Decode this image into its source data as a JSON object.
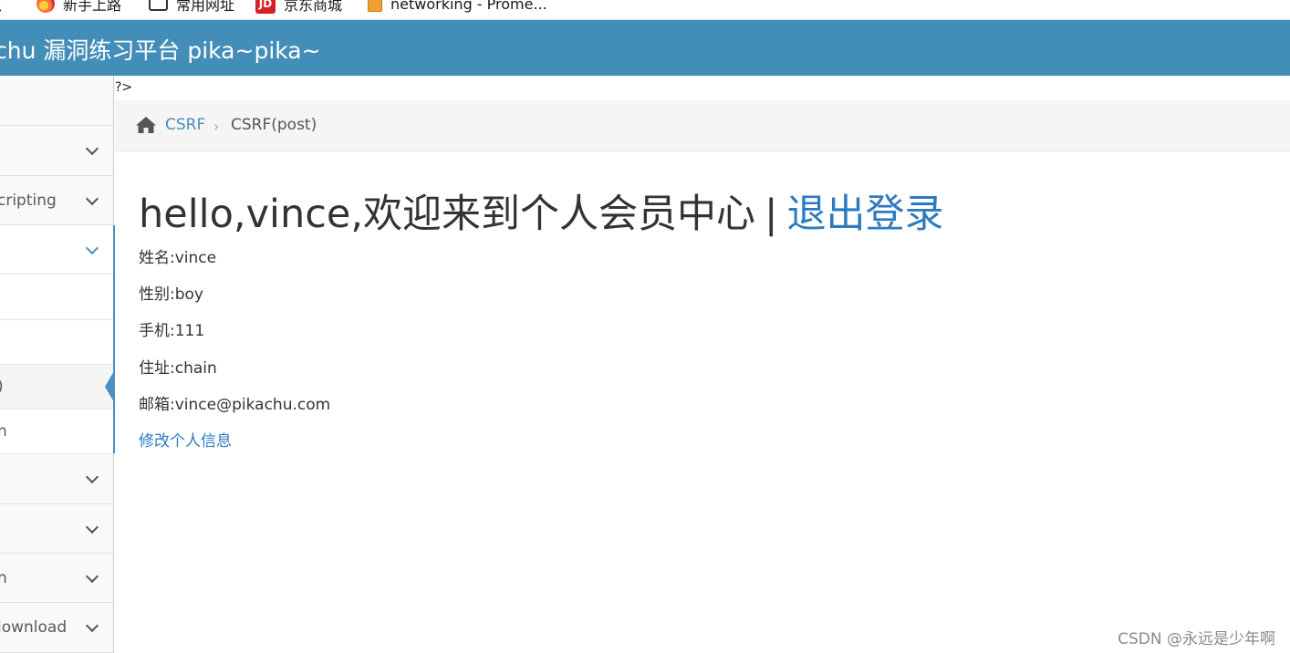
{
  "bookmarks": [
    {
      "label": "点",
      "icon": "bookmark-star-icon"
    },
    {
      "label": "新手上路",
      "icon": "firefox-icon"
    },
    {
      "label": "常用网址",
      "icon": "folder-icon"
    },
    {
      "label": "京东商城",
      "icon": "jd-icon",
      "glyph": "JD"
    },
    {
      "label": "networking - Prome...",
      "icon": "document-icon"
    }
  ],
  "navbar": {
    "brand": "chu 漏洞练习平台 pika~pika~",
    "color": "#438eb9"
  },
  "sidebar": {
    "items": [
      {
        "label": "",
        "chevron": false
      },
      {
        "label": "",
        "chevron": true
      },
      {
        "label": "cripting",
        "chevron": true
      },
      {
        "label": "",
        "chevron": true,
        "open": true
      },
      {
        "label": "",
        "sub": true
      },
      {
        "label": "",
        "sub": true
      },
      {
        "label": ")",
        "sub": true,
        "active": true
      },
      {
        "label": "n",
        "sub": true
      },
      {
        "label": "",
        "chevron": true
      },
      {
        "label": "",
        "chevron": true
      },
      {
        "label": "n",
        "chevron": true
      },
      {
        "label": "lownload",
        "chevron": true
      }
    ]
  },
  "stray_text": "?>",
  "breadcrumbs": {
    "home_icon": "home-icon",
    "parent": "CSRF",
    "separator": "›",
    "current": "CSRF(post)"
  },
  "member": {
    "greeting": "hello,vince,欢迎来到个人会员中心",
    "separator": "|",
    "logout": "退出登录",
    "name": "姓名:vince",
    "sex": "性别:boy",
    "phone": "手机:111",
    "address": "住址:chain",
    "email": "邮箱:vince@pikachu.com",
    "edit_link": "修改个人信息"
  },
  "watermark": "CSDN @永远是少年啊"
}
